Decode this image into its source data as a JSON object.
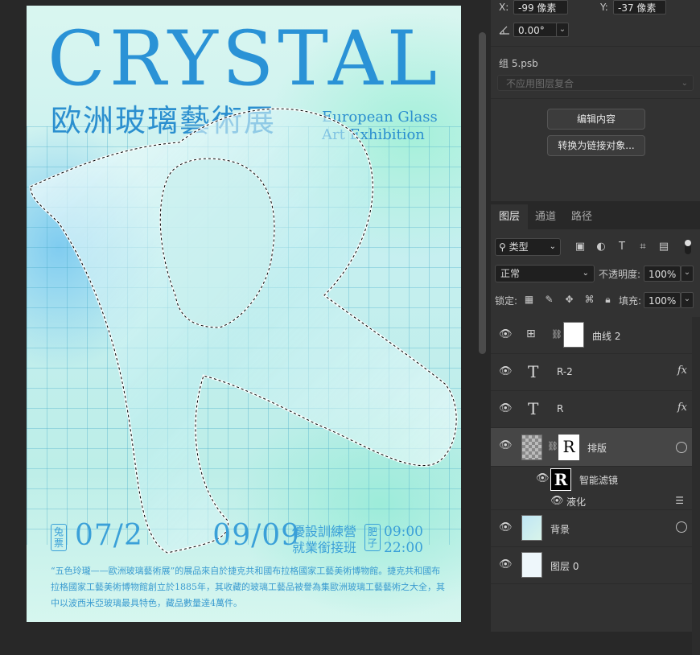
{
  "poster": {
    "title_en": "CRYSTAL",
    "title_cn": "欧洲玻璃藝術展",
    "subtitle_en_line1": "European Glass",
    "subtitle_en_line2": "Art Exhibition",
    "stamp_free": "兔票",
    "dates": "07/2   09/09",
    "course_line1": "優設訓練營",
    "course_line2": "就業銜接班",
    "stamp_fat": "肥子",
    "time_line1": "09:00",
    "time_line2": "22:00",
    "body_text": "“五色玲瓏——歐洲玻璃藝術展”的展品來自於捷克共和國布拉格國家工藝美術博物館。捷克共和國布拉格國家工藝美術博物館創立於1885年，其收藏的玻璃工藝品被譽為集歐洲玻璃工藝藝術之大全，其中以波西米亞玻璃最具特色，藏品數量達4萬件。"
  },
  "properties": {
    "x_label": "X:",
    "x_value": "-99 像素",
    "y_label": "Y:",
    "y_value": "-37 像素",
    "angle_icon": "angle-icon",
    "angle_value": "0.00°",
    "group_name": "组 5.psb",
    "layer_comp_placeholder": "不应用图层复合",
    "edit_contents_label": "编辑内容",
    "convert_linked_label": "转换为链接对象..."
  },
  "layers_panel": {
    "tabs": [
      "图层",
      "通道",
      "路径"
    ],
    "active_tab": 0,
    "kind_filter": "类型",
    "blend_mode": "正常",
    "opacity_label": "不透明度:",
    "opacity_value": "100%",
    "lock_label": "锁定:",
    "fill_label": "填充:",
    "fill_value": "100%",
    "layers": [
      {
        "name": "曲线 2",
        "type": "adjustment",
        "has_fx": false,
        "selected": false
      },
      {
        "name": "R-2",
        "type": "text",
        "has_fx": true,
        "selected": false
      },
      {
        "name": "R",
        "type": "text",
        "has_fx": true,
        "selected": false
      },
      {
        "name": "排版",
        "type": "smart",
        "has_fx": false,
        "selected": true
      },
      {
        "name": "智能滤镜",
        "type": "smart-filter-header"
      },
      {
        "name": "液化",
        "type": "smart-filter-item"
      },
      {
        "name": "背景",
        "type": "smart",
        "has_fx": false,
        "selected": false
      },
      {
        "name": "图层 0",
        "type": "pixel",
        "has_fx": false,
        "selected": false
      }
    ],
    "fx_label": "fx"
  },
  "colors": {
    "panel_bg": "#323232",
    "app_bg": "#282828",
    "poster_accent": "#2a92d6"
  }
}
